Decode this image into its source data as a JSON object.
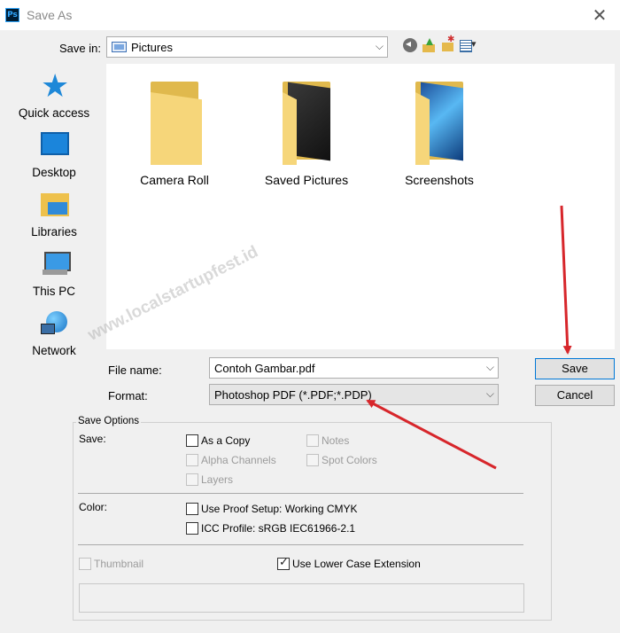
{
  "window": {
    "title": "Save As",
    "app_icon": "Ps",
    "close_glyph": "✕"
  },
  "location": {
    "label": "Save in:",
    "value": "Pictures"
  },
  "sidebar": {
    "items": [
      {
        "label": "Quick access",
        "icon": "star-icon"
      },
      {
        "label": "Desktop",
        "icon": "desktop-icon"
      },
      {
        "label": "Libraries",
        "icon": "libraries-icon"
      },
      {
        "label": "This PC",
        "icon": "computer-icon"
      },
      {
        "label": "Network",
        "icon": "network-icon"
      }
    ]
  },
  "files": [
    {
      "name": "Camera Roll",
      "style": "plain"
    },
    {
      "name": "Saved Pictures",
      "style": "dark"
    },
    {
      "name": "Screenshots",
      "style": "blue"
    }
  ],
  "form": {
    "filename_label": "File name:",
    "filename_value": "Contoh Gambar.pdf",
    "format_label": "Format:",
    "format_value": "Photoshop PDF (*.PDF;*.PDP)",
    "save_label": "Save",
    "cancel_label": "Cancel"
  },
  "save_options": {
    "legend": "Save Options",
    "save_label": "Save:",
    "as_a_copy": "As a Copy",
    "notes": "Notes",
    "alpha_channels": "Alpha Channels",
    "spot_colors": "Spot Colors",
    "layers": "Layers",
    "color_label": "Color:",
    "use_proof_setup": "Use Proof Setup:  Working CMYK",
    "icc_profile": "ICC Profile:  sRGB IEC61966-2.1",
    "thumbnail": "Thumbnail",
    "lower_case_ext": "Use Lower Case Extension"
  },
  "watermark": "www.localstartupfest.id",
  "colors": {
    "annotation_arrow": "#d7262b",
    "default_button_border": "#0078d7"
  }
}
